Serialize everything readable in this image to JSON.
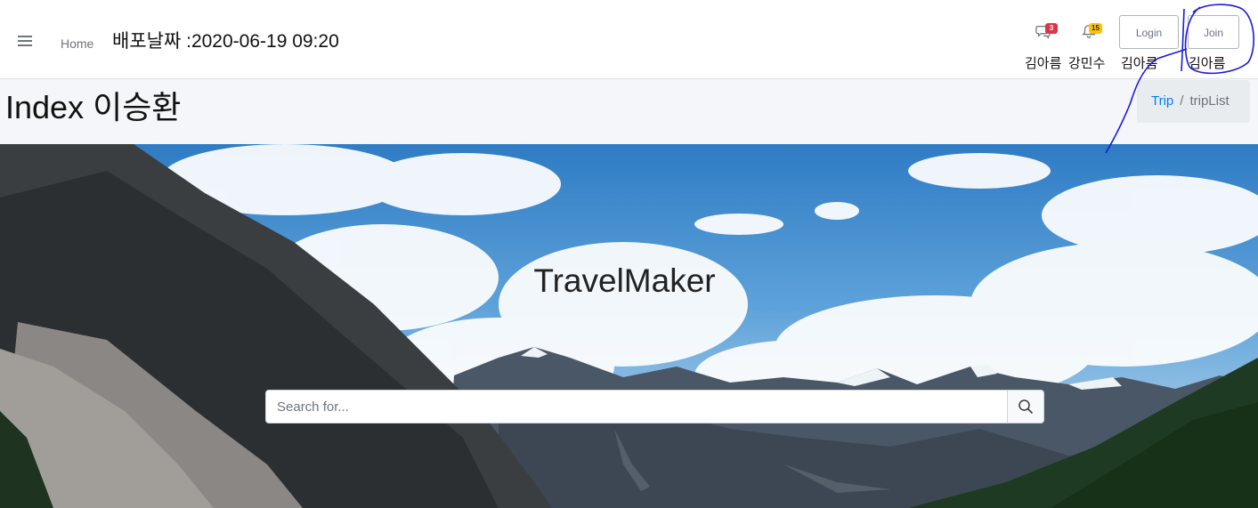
{
  "navbar": {
    "home_label": "Home",
    "deploy_date": "배포날짜 :2020-06-19 09:20",
    "messages": {
      "icon": "comments-icon",
      "badge": "3",
      "user": "김아름"
    },
    "notifications": {
      "icon": "bell-icon",
      "badge": "15",
      "user": "강민수"
    },
    "login": {
      "label": "Login",
      "user": "김아름"
    },
    "join": {
      "label": "Join",
      "user": "김아름"
    }
  },
  "header": {
    "title": "Index 이승환",
    "breadcrumb": {
      "parent": "Trip",
      "current": "tripList"
    }
  },
  "hero": {
    "title": "TravelMaker",
    "search_placeholder": "Search for...",
    "search_icon": "search-icon"
  },
  "colors": {
    "link": "#007bff",
    "badge_danger": "#dc3545",
    "badge_warning": "#ffc107",
    "annotation_ink": "#1a1adb"
  }
}
